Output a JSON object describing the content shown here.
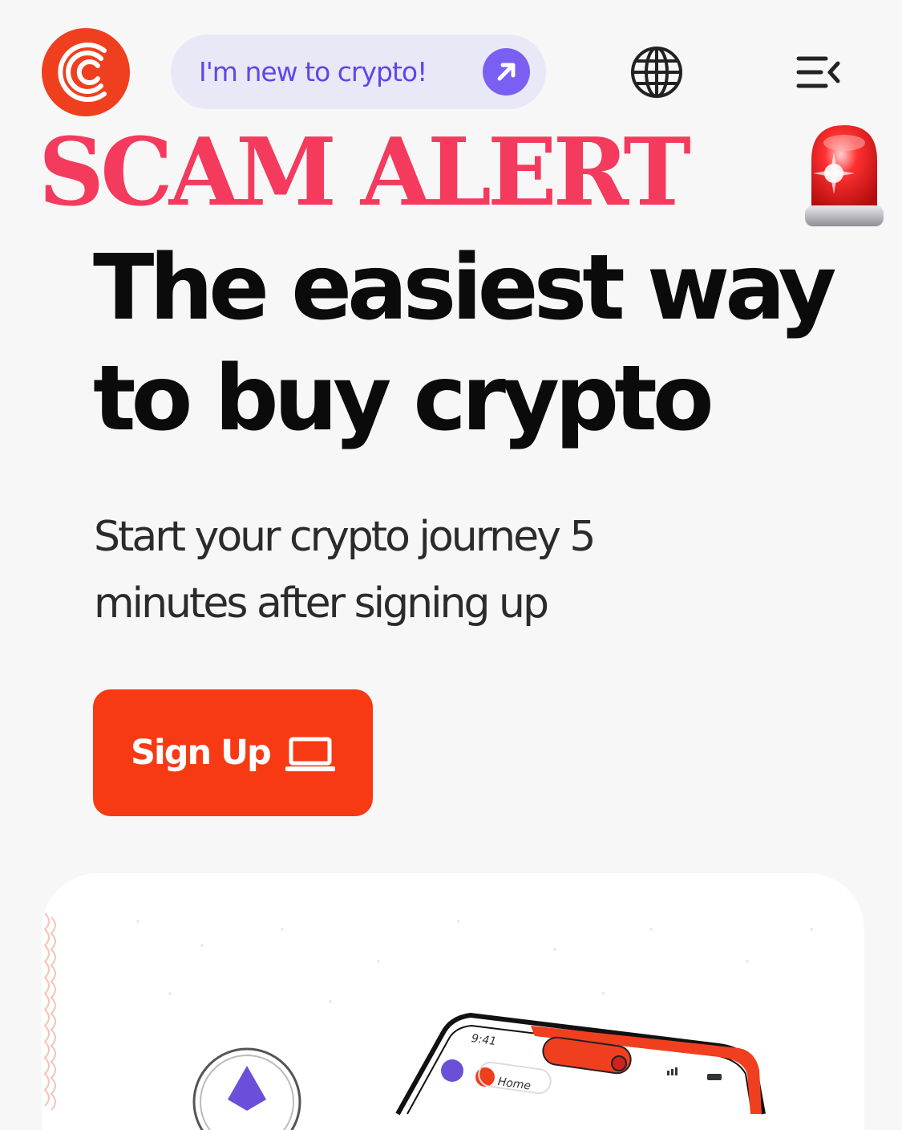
{
  "header": {
    "new_to_crypto_label": "I'm new to crypto!"
  },
  "overlay": {
    "scam_alert_text": "SCAM ALERT"
  },
  "hero": {
    "title": "The easiest way to buy crypto",
    "subtitle": "Start your crypto journey 5 minutes after signing up",
    "signup_label": "Sign Up"
  },
  "phone_mockup": {
    "time": "9:41",
    "home_label": "Home"
  },
  "colors": {
    "brand_orange": "#f73a14",
    "pill_bg": "#e9e8f6",
    "pill_text": "#6145e8",
    "scam_red": "#f43a5d"
  },
  "icons": {
    "logo": "brand-c-logo-icon",
    "pill_arrow": "arrow-up-right-icon",
    "globe": "globe-icon",
    "menu": "menu-collapse-icon",
    "siren": "police-siren-icon",
    "signup": "laptop-icon"
  }
}
